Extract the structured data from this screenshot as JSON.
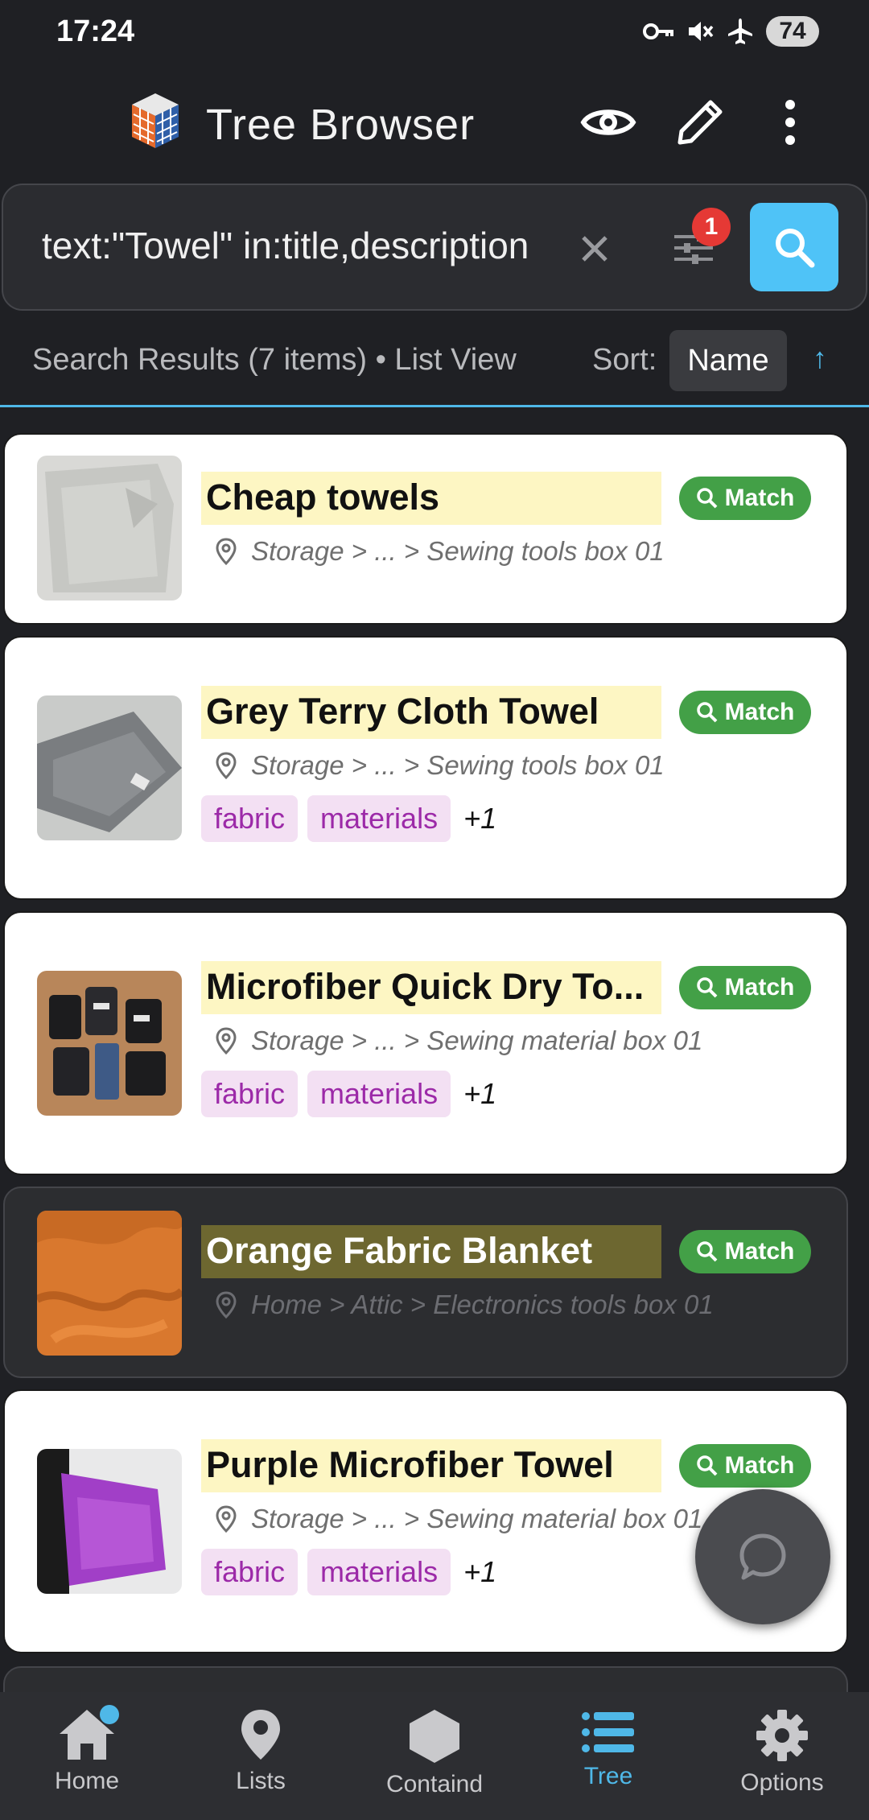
{
  "status": {
    "time": "17:24",
    "battery": "74"
  },
  "header": {
    "title": "Tree Browser"
  },
  "search": {
    "query": "text:\"Towel\" in:title,description",
    "filter_count": "1"
  },
  "results": {
    "summary": "Search Results (7 items) • List View",
    "sort_label": "Sort:",
    "sort_value": "Name",
    "sort_direction": "↑"
  },
  "items": [
    {
      "title": "Cheap towels",
      "path": "Storage > ... > Sewing tools box 01",
      "match": "Match",
      "tags": []
    },
    {
      "title": "Grey Terry Cloth Towel",
      "path": "Storage > ... > Sewing tools box 01",
      "match": "Match",
      "tags": [
        "fabric",
        "materials"
      ],
      "more": "+1"
    },
    {
      "title": "Microfiber Quick Dry To...",
      "path": "Storage > ... > Sewing material box 01",
      "match": "Match",
      "tags": [
        "fabric",
        "materials"
      ],
      "more": "+1"
    },
    {
      "title": "Orange Fabric Blanket",
      "path": "Home > Attic > Electronics tools box 01",
      "match": "Match",
      "tags": []
    },
    {
      "title": "Purple Microfiber Towel",
      "path": "Storage > ... > Sewing material box 01",
      "match": "Match",
      "tags": [
        "fabric",
        "materials"
      ],
      "more": "+1"
    }
  ],
  "nav": {
    "home": "Home",
    "lists": "Lists",
    "contained": "Containd",
    "tree": "Tree",
    "options": "Options"
  },
  "colors": {
    "accent": "#4fc3f7",
    "match": "#43a047",
    "highlight": "#fdf6c3",
    "chip_bg": "#f3e0f3",
    "chip_text": "#9c2aa8"
  }
}
